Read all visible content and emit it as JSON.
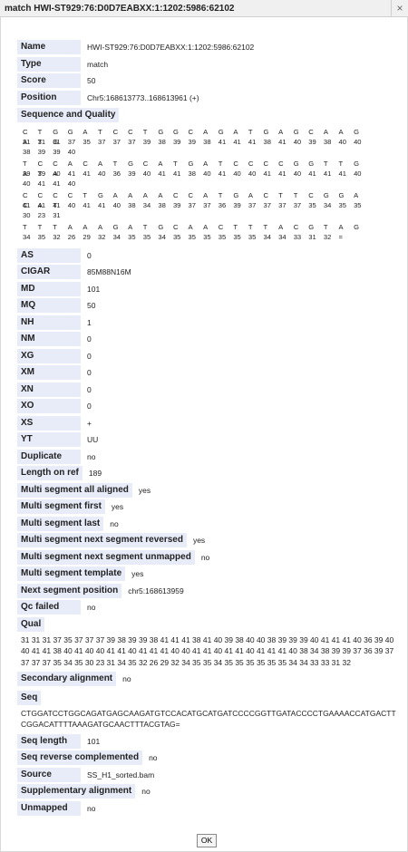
{
  "window": {
    "title": "match HWI-ST929:76:D0D7EABXX:1:1202:5986:62102",
    "close_glyph": "×"
  },
  "fields_top": [
    {
      "label": "Name",
      "value": "HWI-ST929:76:D0D7EABXX:1:1202:5986:62102"
    },
    {
      "label": "Type",
      "value": "match"
    },
    {
      "label": "Score",
      "value": "50"
    },
    {
      "label": "Position",
      "value": "Chr5:168613773..168613961 (+)"
    }
  ],
  "sequence_quality": {
    "label": "Sequence and Quality",
    "rows": [
      {
        "bases": [
          "C",
          "T",
          "G",
          "G",
          "A",
          "T",
          "C",
          "C",
          "T",
          "G",
          "G",
          "C",
          "A",
          "G",
          "A",
          "T",
          "G",
          "A",
          "G",
          "C",
          "A",
          "A",
          "G",
          "A",
          "T",
          "G"
        ],
        "quals": [
          "31",
          "31",
          "31",
          "37",
          "35",
          "37",
          "37",
          "37",
          "39",
          "38",
          "39",
          "39",
          "38",
          "41",
          "41",
          "41",
          "38",
          "41",
          "40",
          "39",
          "38",
          "40",
          "40",
          "38",
          "39",
          "39",
          "40"
        ]
      },
      {
        "bases": [
          "T",
          "C",
          "C",
          "A",
          "C",
          "A",
          "T",
          "G",
          "C",
          "A",
          "T",
          "G",
          "A",
          "T",
          "C",
          "C",
          "C",
          "C",
          "G",
          "G",
          "T",
          "T",
          "G",
          "A",
          "T",
          "A"
        ],
        "quals": [
          "39",
          "39",
          "40",
          "41",
          "41",
          "40",
          "36",
          "39",
          "40",
          "41",
          "41",
          "38",
          "40",
          "41",
          "40",
          "40",
          "41",
          "41",
          "40",
          "41",
          "41",
          "41",
          "40",
          "40",
          "41",
          "41",
          "40"
        ]
      },
      {
        "bases": [
          "C",
          "C",
          "C",
          "C",
          "T",
          "G",
          "A",
          "A",
          "A",
          "A",
          "C",
          "C",
          "A",
          "T",
          "G",
          "A",
          "C",
          "T",
          "T",
          "C",
          "G",
          "G",
          "A",
          "C",
          "A",
          "T"
        ],
        "quals": [
          "41",
          "41",
          "41",
          "40",
          "41",
          "41",
          "40",
          "38",
          "34",
          "38",
          "39",
          "37",
          "37",
          "36",
          "39",
          "37",
          "37",
          "37",
          "37",
          "35",
          "34",
          "35",
          "35",
          "30",
          "23",
          "31"
        ]
      },
      {
        "bases": [
          "T",
          "T",
          "T",
          "A",
          "A",
          "A",
          "G",
          "A",
          "T",
          "G",
          "C",
          "A",
          "A",
          "C",
          "T",
          "T",
          "T",
          "A",
          "C",
          "G",
          "T",
          "A",
          "G"
        ],
        "quals": [
          "34",
          "35",
          "32",
          "26",
          "29",
          "32",
          "34",
          "35",
          "35",
          "34",
          "35",
          "35",
          "35",
          "35",
          "35",
          "35",
          "34",
          "34",
          "33",
          "31",
          "32",
          "="
        ]
      }
    ]
  },
  "fields_mid": [
    {
      "label": "AS",
      "value": "0"
    },
    {
      "label": "CIGAR",
      "value": "85M88N16M"
    },
    {
      "label": "MD",
      "value": "101"
    },
    {
      "label": "MQ",
      "value": "50"
    },
    {
      "label": "NH",
      "value": "1"
    },
    {
      "label": "NM",
      "value": "0"
    },
    {
      "label": "XG",
      "value": "0"
    },
    {
      "label": "XM",
      "value": "0"
    },
    {
      "label": "XN",
      "value": "0"
    },
    {
      "label": "XO",
      "value": "0"
    },
    {
      "label": "XS",
      "value": "+"
    },
    {
      "label": "YT",
      "value": "UU"
    },
    {
      "label": "Duplicate",
      "value": "no"
    },
    {
      "label": "Length on ref",
      "value": "189"
    },
    {
      "label": "Multi segment all aligned",
      "value": "yes"
    },
    {
      "label": "Multi segment first",
      "value": "yes"
    },
    {
      "label": "Multi segment last",
      "value": "no"
    },
    {
      "label": "Multi segment next segment reversed",
      "value": "yes"
    },
    {
      "label": "Multi segment next segment unmapped",
      "value": "no"
    },
    {
      "label": "Multi segment template",
      "value": "yes"
    },
    {
      "label": "Next segment position",
      "value": "chr5:168613959"
    },
    {
      "label": "Qc failed",
      "value": "no"
    }
  ],
  "qual": {
    "label": "Qual",
    "value": "31 31 31 37 35 37 37 37 39 38 39 39 38 41 41 41 38 41 40 39 38 40 40 38 39 39 39 40 41 41 41 40 36 39 40 40 41 41 38 40 41 40 40 41 41 40 41 41 41 40 40 41 41 40 41 41 40 41 41 41 40 38 34 38 39 39 37 36 39 37 37 37 37 35 34 35 30 23 31 34 35 32 26 29 32 34 35 35 34 35 35 35 35 35 35 34 34 33 33 31 32"
  },
  "secondary": {
    "label": "Secondary alignment",
    "value": "no"
  },
  "seq": {
    "label": "Seq",
    "value": "CTGGATCCTGGCAGATGAGCAAGATGTCCACATGCATGATCCCCGGTTGATACCCCTGAAAACCATGACTTCGGACATTTTAAAGATGCAACTTTACGTAG="
  },
  "fields_bottom": [
    {
      "label": "Seq length",
      "value": "101"
    },
    {
      "label": "Seq reverse complemented",
      "value": "no"
    },
    {
      "label": "Source",
      "value": "SS_H1_sorted.bam"
    },
    {
      "label": "Supplementary alignment",
      "value": "no"
    },
    {
      "label": "Unmapped",
      "value": "no"
    }
  ],
  "ok_button": "OK"
}
